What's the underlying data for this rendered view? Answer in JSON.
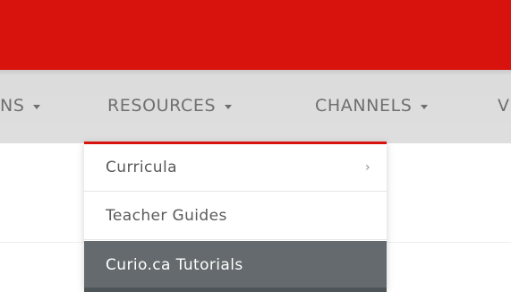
{
  "nav": {
    "items": [
      {
        "label": "NS"
      },
      {
        "label": "RESOURCES"
      },
      {
        "label": "CHANNELS"
      },
      {
        "label": "V"
      }
    ]
  },
  "dropdown": {
    "items": [
      {
        "label": "Curricula",
        "chevron": "›"
      },
      {
        "label": "Teacher Guides"
      },
      {
        "label": "Curio.ca Tutorials"
      }
    ]
  },
  "colors": {
    "brand_red": "#d8120c",
    "nav_background": "#dddddd",
    "highlight": "#646a6d"
  }
}
